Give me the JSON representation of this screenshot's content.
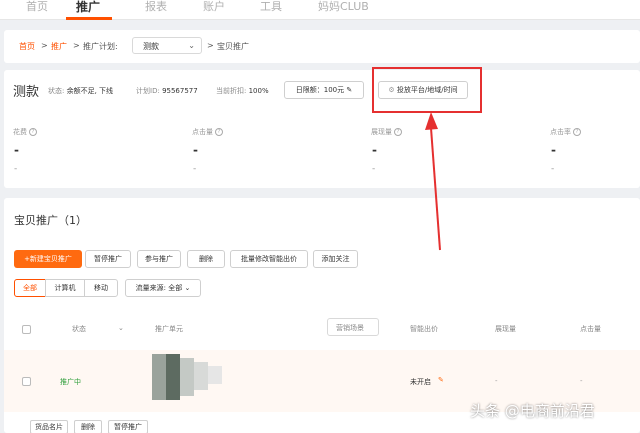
{
  "nav": {
    "items": [
      "首页",
      "推广",
      "报表",
      "账户",
      "工具",
      "妈妈CLUB"
    ],
    "active_index": 1
  },
  "breadcrumb": {
    "home": "首页",
    "promotion": "推广",
    "plan_label": "推广计划:",
    "plan_select": "测款",
    "current": "宝贝推广",
    "sep": ">"
  },
  "plan": {
    "name": "测款",
    "status_label": "状态:",
    "status_value": "余额不足, 下线",
    "id_label": "计划ID:",
    "id_value": "95567577",
    "discount_label": "当前折扣:",
    "discount_value": "100%",
    "budget_button": "日限额：100元 ✎",
    "settings_button": "投放平台/地域/时间"
  },
  "metrics": [
    {
      "label": "花费",
      "value": "-",
      "sub": "-"
    },
    {
      "label": "点击量",
      "value": "-",
      "sub": "-"
    },
    {
      "label": "展现量",
      "value": "-",
      "sub": "-"
    },
    {
      "label": "点击率",
      "value": "-",
      "sub": "-"
    }
  ],
  "items_section": {
    "title": "宝贝推广（1）",
    "buttons": [
      "+新建宝贝推广",
      "暂停推广",
      "参与推广",
      "删除",
      "批量修改智能出价",
      "添加关注"
    ],
    "segments": [
      "全部",
      "计算机",
      "移动"
    ],
    "traffic_label": "流量来源: 全部"
  },
  "table": {
    "headers": [
      "状态",
      "推广单元",
      "营销场景",
      "智能出价",
      "展现量",
      "点击量"
    ],
    "row": {
      "status": "推广中",
      "smart_bid": "未开启",
      "impressions": "-",
      "clicks": "-"
    },
    "row_actions": [
      "货品名片",
      "删除",
      "暂停推广"
    ]
  },
  "watermark": "头条 @电商前沿君",
  "colors": {
    "accent": "#ff5000",
    "highlight_box": "#e53030",
    "status_green": "#2e9e3a"
  }
}
